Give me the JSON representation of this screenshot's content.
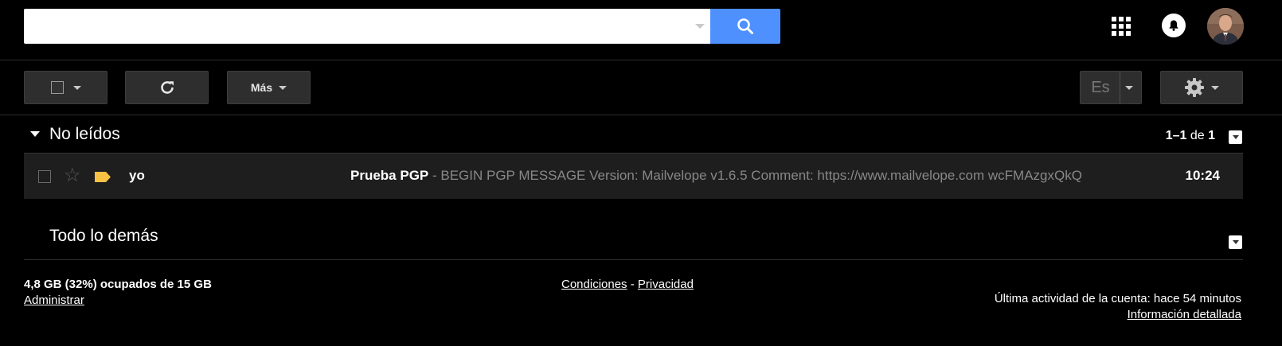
{
  "search": {
    "placeholder": "",
    "value": ""
  },
  "header": {
    "icons": [
      "search-icon",
      "apps-grid-icon",
      "bell-icon",
      "avatar"
    ]
  },
  "toolbar": {
    "select_icon": "checkbox-icon",
    "refresh_icon": "refresh-icon",
    "more_label": "Más",
    "input_tools_label": "Es",
    "settings_icon": "gear-icon"
  },
  "sections": {
    "unread": {
      "title": "No leídos",
      "pager": {
        "range": "1–1",
        "of": "de",
        "total": "1"
      }
    },
    "rest": {
      "title": "Todo lo demás"
    }
  },
  "emails": [
    {
      "sender": "yo",
      "subject": "Prueba PGP",
      "separator": " - ",
      "snippet": "BEGIN PGP MESSAGE Version: Mailvelope v1.6.5 Comment: https://www.mailvelope.com wcFMAzgxQkQ",
      "time": "10:24",
      "starred": false,
      "important": true
    }
  ],
  "footer": {
    "storage": "4,8 GB (32%) ocupados de 15 GB",
    "manage": "Administrar",
    "terms": "Condiciones",
    "sep": " - ",
    "privacy": "Privacidad",
    "last_activity": "Última actividad de la cuenta: hace 54 minutos",
    "details": "Información detallada"
  },
  "colors": {
    "background": "#000000",
    "search_button": "#4d90fe",
    "important_tag": "#f6c244",
    "row_bg": "#1e1e1e"
  }
}
